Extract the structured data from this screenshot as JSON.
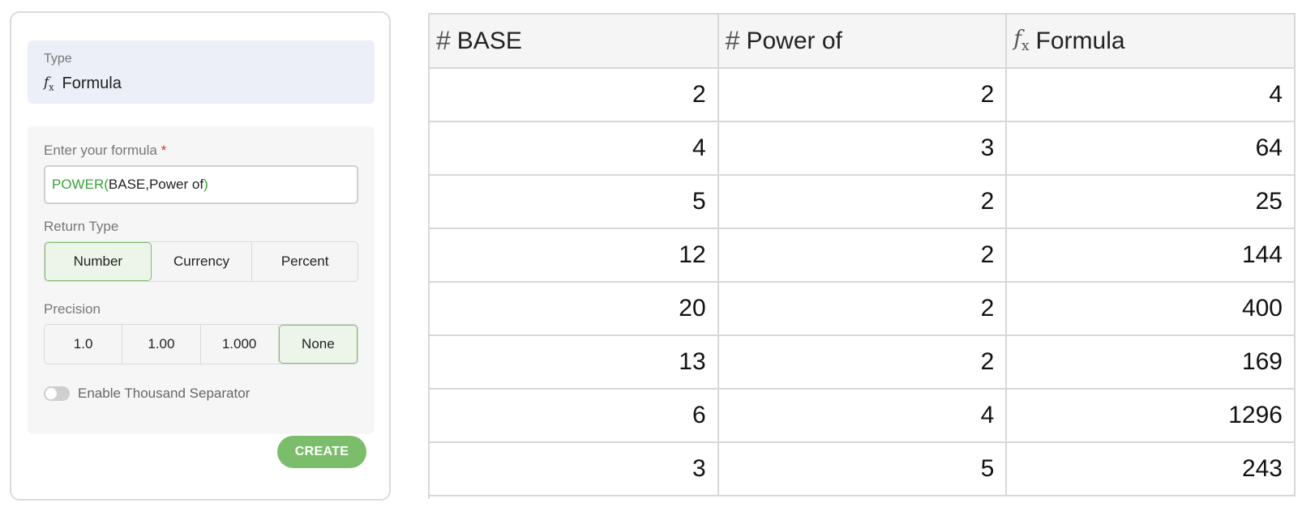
{
  "type_section": {
    "label": "Type",
    "icon": "formula-icon",
    "value": "Formula"
  },
  "formula": {
    "label": "Enter your formula",
    "required_mark": "*",
    "fn_name": "POWER(",
    "args": "BASE,Power of",
    "close": ")"
  },
  "return_type": {
    "label": "Return Type",
    "options": [
      "Number",
      "Currency",
      "Percent"
    ],
    "selected": "Number"
  },
  "precision": {
    "label": "Precision",
    "options": [
      "1.0",
      "1.00",
      "1.000",
      "None"
    ],
    "selected": "None"
  },
  "thousand_separator": {
    "label": "Enable Thousand Separator",
    "enabled": false
  },
  "create_label": "CREATE",
  "table": {
    "headers": [
      {
        "icon": "hash-icon",
        "label": "BASE"
      },
      {
        "icon": "hash-icon",
        "label": "Power of"
      },
      {
        "icon": "formula-icon",
        "label": "Formula"
      }
    ],
    "rows": [
      [
        "2",
        "2",
        "4"
      ],
      [
        "4",
        "3",
        "64"
      ],
      [
        "5",
        "2",
        "25"
      ],
      [
        "12",
        "2",
        "144"
      ],
      [
        "20",
        "2",
        "400"
      ],
      [
        "13",
        "2",
        "169"
      ],
      [
        "6",
        "4",
        "1296"
      ],
      [
        "3",
        "5",
        "243"
      ]
    ]
  },
  "colors": {
    "accent_green": "#7cbd6b",
    "formula_fn": "#3aa33a",
    "required": "#e03030",
    "type_bg": "#eceef8"
  }
}
